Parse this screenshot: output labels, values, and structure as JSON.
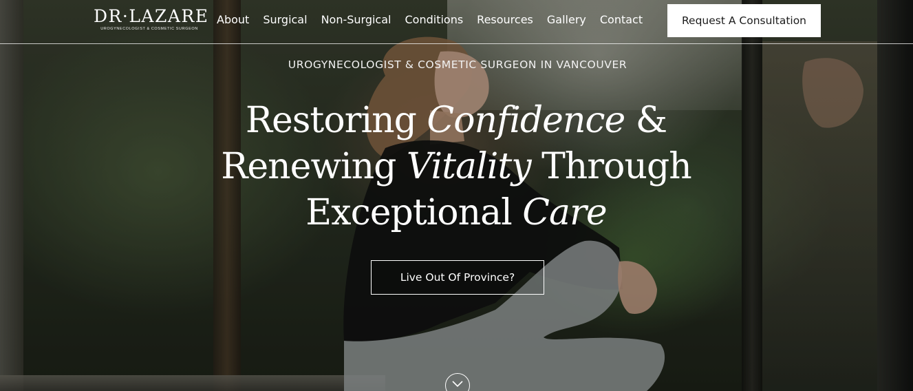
{
  "header": {
    "logo": {
      "name": "DR·LAZARE",
      "tagline": "UROGYNECOLOGIST & COSMETIC SURGEON"
    },
    "nav": [
      "About",
      "Surgical",
      "Non-Surgical",
      "Conditions",
      "Resources",
      "Gallery",
      "Contact"
    ],
    "cta_label": "Request A Consultation"
  },
  "hero": {
    "eyebrow": "UROGYNECOLOGIST & COSMETIC SURGEON IN VANCOUVER",
    "headline": {
      "line1_a": "Restoring ",
      "line1_em": "Confidence",
      "line1_b": " &",
      "line2_a": "Renewing ",
      "line2_em": "Vitality",
      "line2_b": " Through",
      "line3_a": "Exceptional ",
      "line3_em": "Care"
    },
    "button_label": "Live Out Of Province?",
    "scroll_icon": "chevron-down-icon"
  },
  "colors": {
    "accent": "#ffffff",
    "cta_text": "#1b1b1b",
    "overlay": "rgba(0,0,0,0.22)"
  }
}
